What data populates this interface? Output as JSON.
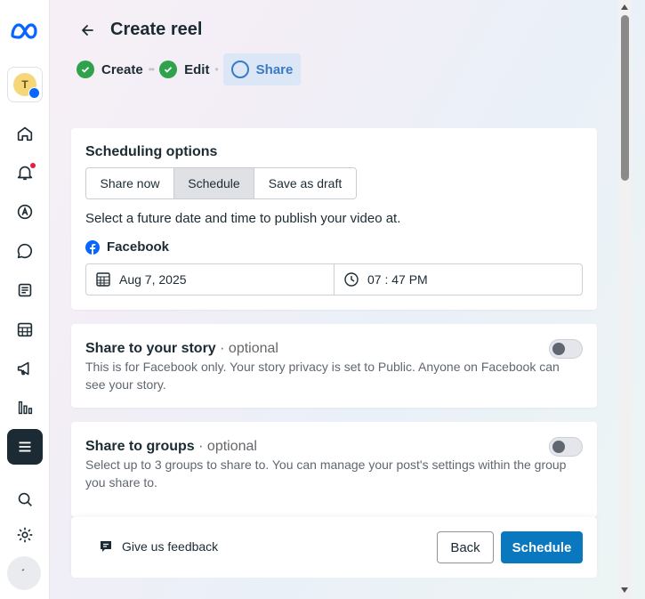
{
  "header": {
    "title": "Create reel",
    "steps": [
      {
        "label": "Create",
        "status": "complete"
      },
      {
        "label": "Edit",
        "status": "complete"
      },
      {
        "label": "Share",
        "status": "current"
      }
    ]
  },
  "scheduling": {
    "title": "Scheduling options",
    "options": [
      "Share now",
      "Schedule",
      "Save as draft"
    ],
    "selected": "Schedule",
    "instruction": "Select a future date and time to publish your video at.",
    "platform_label": "Facebook",
    "date_value": "Aug 7, 2025",
    "time_value": "07 : 47 PM"
  },
  "story": {
    "title": "Share to your story",
    "optional": "· optional",
    "description": "This is for Facebook only. Your story privacy is set to Public. Anyone on Facebook can see your story.",
    "enabled": false
  },
  "groups": {
    "title": "Share to groups",
    "optional": "· optional",
    "description": "Select up to 3 groups to share to. You can manage your post's settings within the group you share to.",
    "enabled": false
  },
  "footer": {
    "feedback_label": "Give us feedback",
    "back_label": "Back",
    "primary_label": "Schedule"
  },
  "sidebar": {
    "profile_initial": "T",
    "items": [
      "home-icon",
      "notifications-icon",
      "ads-icon",
      "messages-icon",
      "content-icon",
      "planner-icon",
      "megaphone-icon",
      "insights-icon",
      "menu-icon",
      "search-icon",
      "settings-icon"
    ]
  },
  "colors": {
    "primary": "#0a78be",
    "step_complete": "#31a24c",
    "step_current": "#3a7ac5",
    "notification": "#e41e3f"
  }
}
